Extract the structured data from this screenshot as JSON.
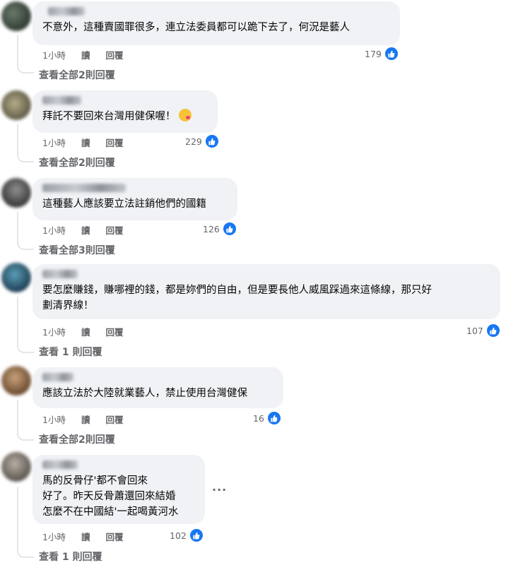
{
  "comments": [
    {
      "text": "不意外，這種賣國罪很多，連立法委員都可以跪下去了，何況是藝人",
      "time": "1小時",
      "read": "讀",
      "reply": "回覆",
      "likes": "179",
      "replies_link": "查看全部2則回覆"
    },
    {
      "text": "拜託不要回來台灣用健保喔！",
      "time": "1小時",
      "read": "讀",
      "reply": "回覆",
      "likes": "229",
      "replies_link": "查看全部2則回覆"
    },
    {
      "text": "這種藝人應該要立法註銷他們的國籍",
      "time": "1小時",
      "read": "讀",
      "reply": "回覆",
      "likes": "126",
      "replies_link": "查看全部3則回覆"
    },
    {
      "text": "要怎麼賺錢，賺哪裡的錢，都是妳們的自由，但是要長他人威風踩過來這條線，那只好\n劃清界線！",
      "time": "1小時",
      "read": "讀",
      "reply": "回覆",
      "likes": "107",
      "replies_link": "查看 1 則回覆"
    },
    {
      "text": "應該立法於大陸就業藝人，禁止使用台灣健保",
      "time": "1小時",
      "read": "讀",
      "reply": "回覆",
      "likes": "16",
      "replies_link": "查看全部2則回覆"
    },
    {
      "text": "馬的反骨仔'都不會回來\n好了。昨天反骨蕭還回來結婚\n怎麼不在中國結'一起喝黃河水",
      "time": "1小時",
      "read": "讀",
      "reply": "回覆",
      "likes": "102",
      "replies_link": "查看 1 則回覆",
      "more": "···"
    }
  ],
  "colors": {
    "like_blue": "#1877f2",
    "bubble_bg": "#f0f2f5",
    "meta_gray": "#65676b",
    "text": "#050505"
  },
  "icons": {
    "like": "thumbs-up-icon",
    "emoji": "kissing-face-emoji-icon",
    "more": "more-options-icon"
  }
}
